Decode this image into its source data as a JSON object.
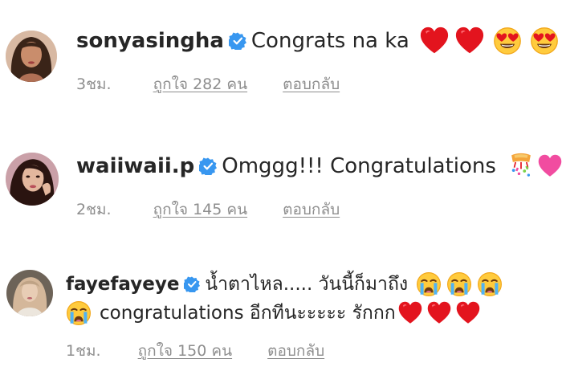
{
  "comments": [
    {
      "username": "sonyasingha",
      "text": "Congrats na ka",
      "emojis": [
        "red-heart",
        "red-heart",
        "heart-eyes",
        "heart-eyes"
      ],
      "time": "3ชม.",
      "likes": "ถูกใจ 282 คน",
      "reply": "ตอบกลับ"
    },
    {
      "username": "waiiwaii.p",
      "text": "Omggg!!! Congratulations",
      "emojis": [
        "confetti-ball",
        "heart"
      ],
      "time": "2ชม.",
      "likes": "ถูกใจ 145 คน",
      "reply": "ตอบกลับ"
    },
    {
      "username": "fayefayeye",
      "text": "น้ำตาไหล..... วันนี้ก็มาถึง",
      "emojis": [
        "loudly-crying",
        "loudly-crying",
        "loudly-crying"
      ],
      "text2": "congratulations อีกทีนะะะะะ รักกก",
      "emojis_line1_lead": [
        "loudly-crying"
      ],
      "emojis_line2": [
        "red-heart",
        "red-heart",
        "red-heart"
      ],
      "time": "1ชม.",
      "likes": "ถูกใจ 150 คน",
      "reply": "ตอบกลับ"
    }
  ],
  "colors": {
    "verified": "#3897f0",
    "meta": "#8e8e8e",
    "heart": "#e3141e"
  }
}
